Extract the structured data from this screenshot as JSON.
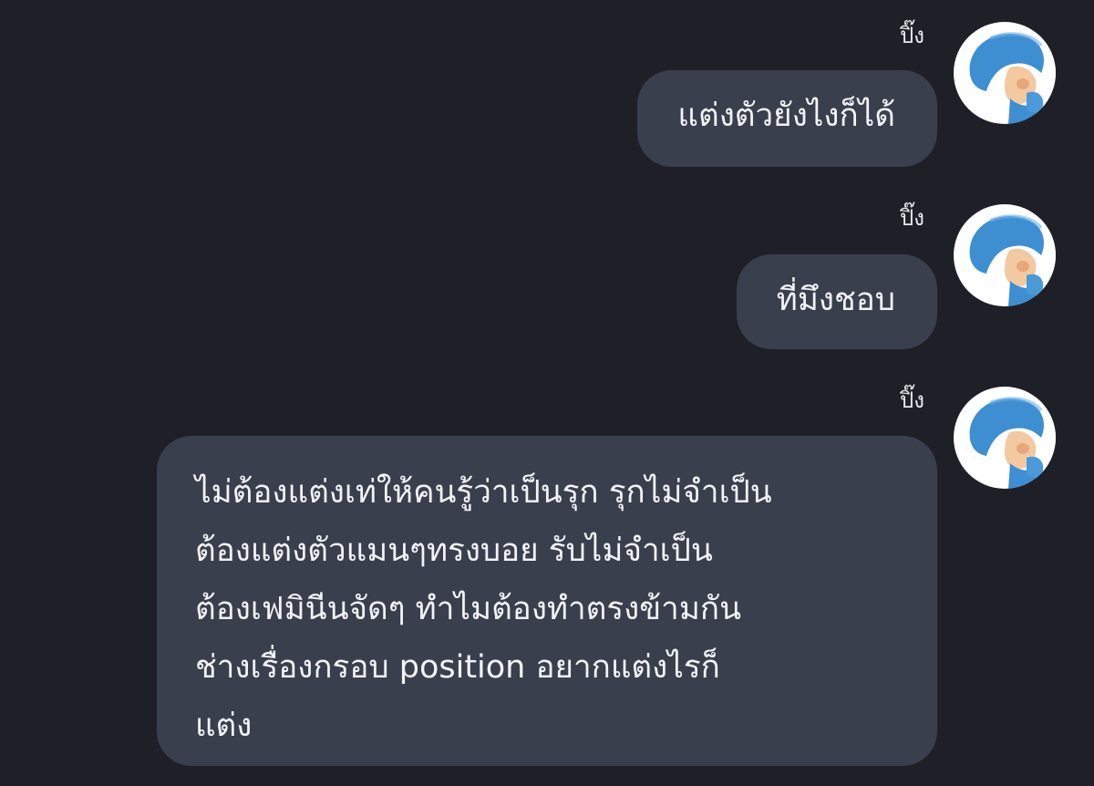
{
  "messages": [
    {
      "sender": "ปิ๊ง",
      "avatar_icon": "pocoyo-avatar-icon",
      "text": "แต่งตัวยังไงก็ได้"
    },
    {
      "sender": "ปิ๊ง",
      "avatar_icon": "pocoyo-avatar-icon",
      "text": "ที่มึงชอบ"
    },
    {
      "sender": "ปิ๊ง",
      "avatar_icon": "pocoyo-avatar-icon",
      "text": "ไม่ต้องแต่งเท่ให้คนรู้ว่าเป็นรุก รุกไม่จำเป็น\nต้องแต่งตัวแมนๆทรงบอย รับไม่จำเป็น\nต้องเฟมินีนจัดๆ ทำไมต้องทำตรงข้ามกัน\nช่างเรื่องกรอบ position อยากแต่งไรก็\nแต่ง"
    }
  ],
  "colors": {
    "background": "#1f1f27",
    "bubble": "#3a3f4e",
    "text": "#f2f3f6",
    "avatar_blue": "#3d8fd1"
  }
}
